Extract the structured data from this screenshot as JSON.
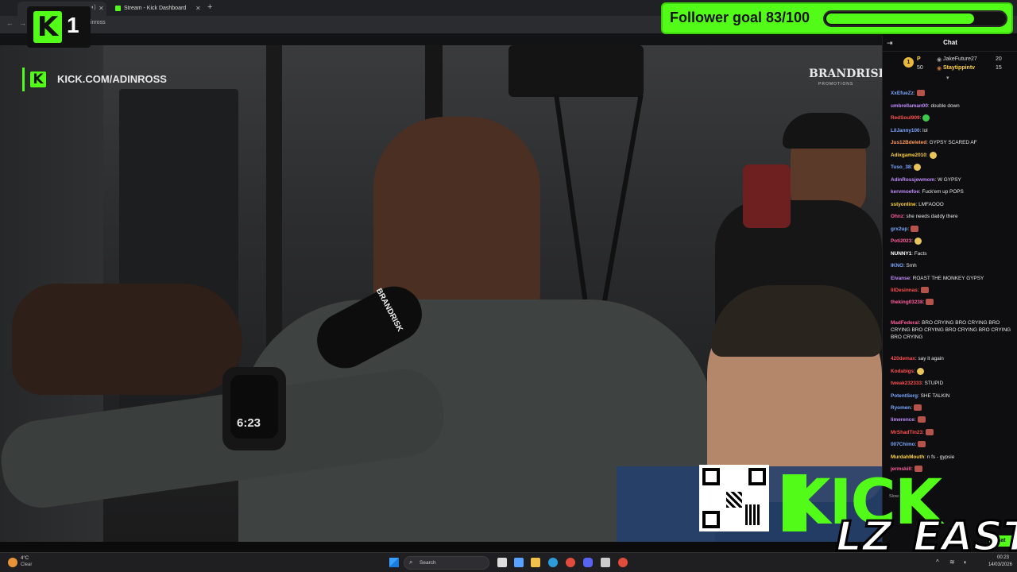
{
  "browser": {
    "tabs": [
      {
        "label": "",
        "close": "✕"
      },
      {
        "label": "Stream - Kick Dashboard",
        "close": "✕"
      }
    ],
    "new_tab": "+",
    "url": "dinross"
  },
  "badge": {
    "number": "1",
    "glyph": "K"
  },
  "follower_goal": {
    "text": "Follower goal 83/100",
    "current": 83,
    "target": 100
  },
  "stream": {
    "watermark_url": "KICK.COM/ADINROSS",
    "sponsor": "BRANDRISK",
    "sponsor_sub": "PROMOTIONS",
    "mic_flag": "BRANDRISK",
    "watch_time": "6:23"
  },
  "chat": {
    "title": "Chat",
    "leaderboard": {
      "first": {
        "rank": "1",
        "name": "P",
        "points": "50"
      },
      "second": {
        "name": "JakeFuture27",
        "points": "20"
      },
      "third": {
        "name": "Staytippintv",
        "points": "15"
      }
    },
    "messages": [
      {
        "user": "XxEfueZz",
        "text": ":",
        "color": "#7aa7ff",
        "emote": "red"
      },
      {
        "user": "umbrellaman00",
        "text": ": double down",
        "color": "#c28cff"
      },
      {
        "user": "RedSoul909",
        "text": ":",
        "color": "#ff5050",
        "emote": "green"
      },
      {
        "user": "LilJanny100",
        "text": ": lol",
        "color": "#7aa7ff"
      },
      {
        "user": "Jus12Bdeleted",
        "text": ": GYPSY SCARED AF",
        "color": "#ff9b5c"
      },
      {
        "user": "Adixgame2010",
        "text": ":",
        "color": "#ffd23f",
        "emote": "yellow"
      },
      {
        "user": "Tuso_38",
        "text": ":",
        "color": "#7aa7ff",
        "emote": "yellow"
      },
      {
        "user": "AdinRossjewmom",
        "text": ": W GYPSY",
        "color": "#c28cff"
      },
      {
        "user": "kervmoefoe",
        "text": ": Fuck'em up POPS",
        "color": "#c28cff"
      },
      {
        "user": "sstyonline",
        "text": ": LMFAOOO",
        "color": "#ffd23f"
      },
      {
        "user": "Ohnz",
        "text": ": she needs daddy there",
        "color": "#ff5d9b"
      },
      {
        "user": "grx2up",
        "text": ":",
        "color": "#7aa7ff",
        "emote": "red"
      },
      {
        "user": "Poti2023",
        "text": ":",
        "color": "#ff5d9b",
        "emote": "yellow"
      },
      {
        "user": "NUNNY1",
        "text": ": Facts",
        "color": "#ffffff"
      },
      {
        "user": "IKNO",
        "text": ": Smh",
        "color": "#7aa7ff"
      },
      {
        "user": "Eivanse",
        "text": ": ROAST THE MONKEY GYPSY",
        "color": "#c28cff"
      },
      {
        "user": "lilDesinnas",
        "text": ":",
        "color": "#ff5050",
        "emote": "red"
      },
      {
        "user": "theking03238",
        "text": ":",
        "color": "#ff5d9b",
        "emote": "red"
      },
      {
        "user": "MadFederal",
        "text": ": BRO CRYING BRO CRYING BRO CRYING BRO CRYING BRO CRYING BRO CRYING BRO CRYING",
        "color": "#ff5d9b"
      },
      {
        "user": "420demax",
        "text": ": say it again",
        "color": "#ff5050"
      },
      {
        "user": "Kodabigs",
        "text": ":",
        "color": "#ff5050",
        "emote": "yellow"
      },
      {
        "user": "tweak232333",
        "text": ": STUPID",
        "color": "#ff5050"
      },
      {
        "user": "PotentSerg",
        "text": ": SHE TALKIN",
        "color": "#7aa7ff"
      },
      {
        "user": "Ryomen",
        "text": ":",
        "color": "#7aa7ff",
        "emote": "red"
      },
      {
        "user": "limerence",
        "text": ":",
        "color": "#c28cff",
        "emote": "red"
      },
      {
        "user": "MrShadTin23",
        "text": ":",
        "color": "#ff5050",
        "emote": "red"
      },
      {
        "user": "007Chimo",
        "text": ":",
        "color": "#7aa7ff",
        "emote": "red"
      },
      {
        "user": "MurdahMouth",
        "text": ": n fs - gypsie",
        "color": "#ffd23f"
      },
      {
        "user": "jermskill",
        "text": ":",
        "color": "#ff5d9b",
        "emote": "red"
      }
    ],
    "slow_mode": "Slow m",
    "chat_button": "Chat"
  },
  "overlay": {
    "brand": "KICK",
    "streamer_tag": "LZ_EAST"
  },
  "taskbar": {
    "temp": "4°C",
    "weather": "Clear",
    "search": "Search",
    "time": "00:23",
    "date": "14/03/2026"
  },
  "colors": {
    "kick_green": "#53fc18"
  }
}
